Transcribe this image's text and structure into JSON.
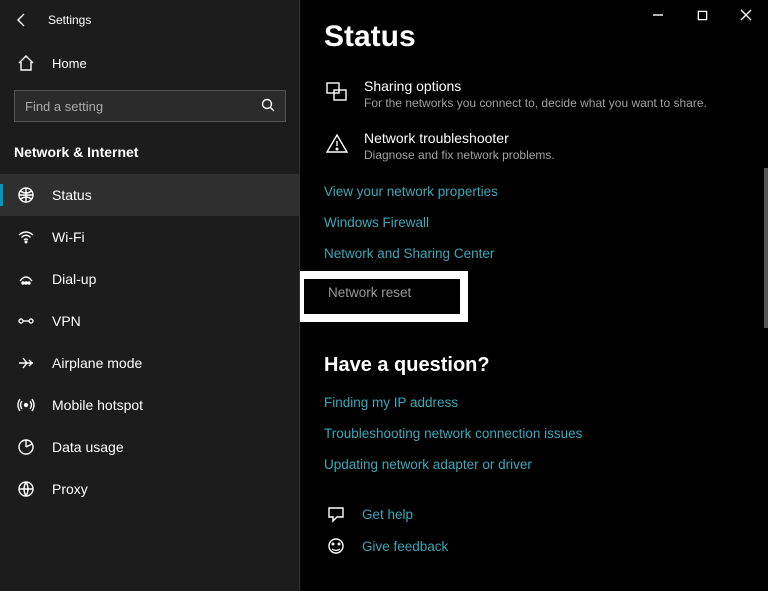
{
  "app_title": "Settings",
  "home_label": "Home",
  "search_placeholder": "Find a setting",
  "section_title": "Network & Internet",
  "nav": [
    {
      "label": "Status",
      "selected": true
    },
    {
      "label": "Wi-Fi",
      "selected": false
    },
    {
      "label": "Dial-up",
      "selected": false
    },
    {
      "label": "VPN",
      "selected": false
    },
    {
      "label": "Airplane mode",
      "selected": false
    },
    {
      "label": "Mobile hotspot",
      "selected": false
    },
    {
      "label": "Data usage",
      "selected": false
    },
    {
      "label": "Proxy",
      "selected": false
    }
  ],
  "page_title": "Status",
  "sharing": {
    "title": "Sharing options",
    "desc": "For the networks you connect to, decide what you want to share."
  },
  "troubleshooter": {
    "title": "Network troubleshooter",
    "desc": "Diagnose and fix network problems."
  },
  "links": {
    "view_props": "View your network properties",
    "firewall": "Windows Firewall",
    "sharing_center": "Network and Sharing Center",
    "network_reset": "Network reset"
  },
  "question_head": "Have a question?",
  "question_links": {
    "finding_ip": "Finding my IP address",
    "troubleshoot": "Troubleshooting network connection issues",
    "updating": "Updating network adapter or driver"
  },
  "help": {
    "get_help": "Get help",
    "feedback": "Give feedback"
  }
}
